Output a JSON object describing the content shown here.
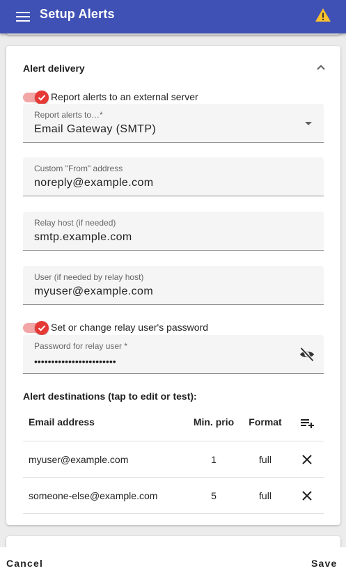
{
  "app": {
    "title": "Setup Alerts",
    "menu_icon": "menu-icon",
    "warning_icon": "warning-icon",
    "warning_color": "#fbc02d",
    "bar_color": "#3f51b5"
  },
  "alert_delivery": {
    "title": "Alert delivery",
    "report_toggle": {
      "label": "Report alerts to an external server",
      "checked": true
    },
    "report_to": {
      "label": "Report alerts to…*",
      "value": "Email Gateway (SMTP)"
    },
    "from_address": {
      "label": "Custom \"From\" address",
      "value": "noreply@example.com"
    },
    "relay_host": {
      "label": "Relay host (if needed)",
      "value": "smtp.example.com"
    },
    "relay_user": {
      "label": "User (if needed by relay host)",
      "value": "myuser@example.com"
    },
    "password_toggle": {
      "label": "Set or change relay user's password",
      "checked": true
    },
    "password": {
      "label": "Password for relay user *",
      "value": "••••••••••••••••••••••••"
    },
    "toggle_color": "#e53935"
  },
  "destinations": {
    "title": "Alert destinations (tap to edit or test):",
    "columns": {
      "email": "Email address",
      "prio": "Min. prio",
      "format": "Format"
    },
    "rows": [
      {
        "email": "myuser@example.com",
        "prio": "1",
        "format": "full"
      },
      {
        "email": "someone-else@example.com",
        "prio": "5",
        "format": "full"
      }
    ]
  },
  "actions": {
    "cancel": "Cancel",
    "save": "Save"
  }
}
